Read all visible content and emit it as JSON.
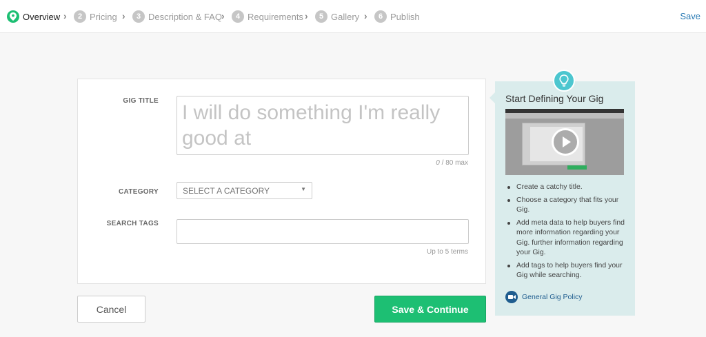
{
  "steps": [
    {
      "num": "1",
      "label": "Overview",
      "active": true
    },
    {
      "num": "2",
      "label": "Pricing"
    },
    {
      "num": "3",
      "label": "Description & FAQ"
    },
    {
      "num": "4",
      "label": "Requirements"
    },
    {
      "num": "5",
      "label": "Gallery"
    },
    {
      "num": "6",
      "label": "Publish"
    }
  ],
  "header": {
    "save_label": "Save"
  },
  "form": {
    "gig_title": {
      "label": "GIG TITLE",
      "placeholder": "I will do something I'm really good at",
      "value": "",
      "count": "0",
      "counter_suffix": "/ 80 max"
    },
    "category": {
      "label": "CATEGORY",
      "selected": "SELECT A CATEGORY"
    },
    "search_tags": {
      "label": "SEARCH TAGS",
      "value": "",
      "hint": "Up to 5 terms"
    }
  },
  "buttons": {
    "cancel": "Cancel",
    "save_continue": "Save & Continue"
  },
  "tips": {
    "title": "Start Defining Your Gig",
    "items": [
      "Create a catchy title.",
      "Choose a category that fits your Gig.",
      "Add meta data to help buyers find more information regarding your Gig. further information regarding your Gig.",
      "Add tags to help buyers find your Gig while searching."
    ],
    "policy_link": "General Gig Policy"
  },
  "colors": {
    "accent_green": "#1dbf73",
    "panel_bg": "#daecec",
    "link_blue": "#1f5d8f",
    "bulb": "#4cc6cf"
  },
  "icons": {
    "step_active": "map-pin-icon",
    "tips": "lightbulb-icon",
    "video": "play-icon",
    "policy": "video-camera-icon"
  }
}
